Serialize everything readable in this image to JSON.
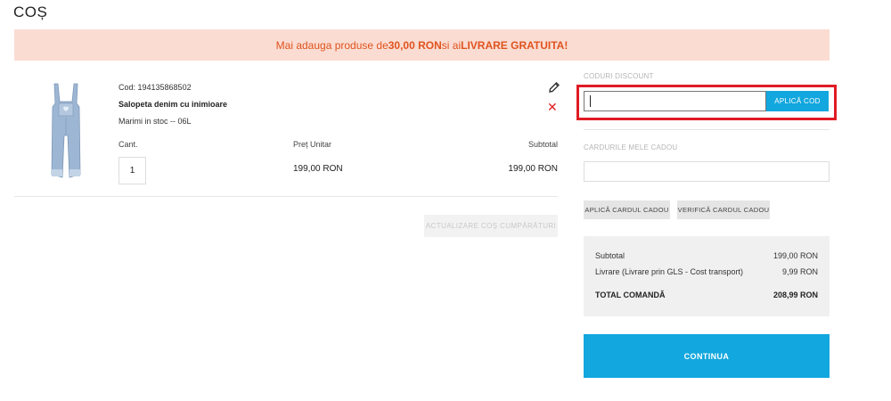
{
  "page": {
    "title": "COȘ"
  },
  "banner": {
    "prefix": "Mai adauga produse de ",
    "amount": "30,00 RON",
    "middle": " si ai ",
    "free": "LIVRARE GRATUITA!"
  },
  "cart": {
    "item": {
      "sku": "Cod: 194135868502",
      "name": "Salopeta denim cu inimioare",
      "stock": "Marimi in stoc -- 06L",
      "quantity": "1",
      "unit_price": "199,00 RON",
      "subtotal": "199,00 RON",
      "image_icon": "overalls-image"
    },
    "labels": {
      "qty": "Cant.",
      "unit_price": "Preț Unitar",
      "subtotal": "Subtotal"
    },
    "update_label": "ACTUALIZARE COȘ CUMPĂRĂTURI",
    "icons": {
      "edit": "pencil-icon",
      "remove": "close-icon",
      "remove_glyph": "✕"
    },
    "colors": {
      "remove": "#e02020"
    }
  },
  "discount": {
    "label": "CODURI DISCOUNT",
    "input_value": "",
    "apply_label": "APLICĂ COD"
  },
  "gift_cards": {
    "label": "CARDURILE MELE CADOU",
    "input_value": "",
    "apply_label": "APLICĂ CARDUL CADOU",
    "verify_label": "VERIFICĂ CARDUL CADOU"
  },
  "totals": {
    "subtotal_label": "Subtotal",
    "subtotal_value": "199,00 RON",
    "shipping_label": "Livrare (Livrare prin GLS - Cost transport)",
    "shipping_value": "9,99 RON",
    "total_label": "TOTAL COMANDĂ",
    "total_value": "208,99 RON"
  },
  "continue_label": "CONTINUA",
  "colors": {
    "accent": "#12a7de",
    "banner_bg": "#fadcd2",
    "banner_text": "#e0531e",
    "highlight": "#e01b24"
  }
}
